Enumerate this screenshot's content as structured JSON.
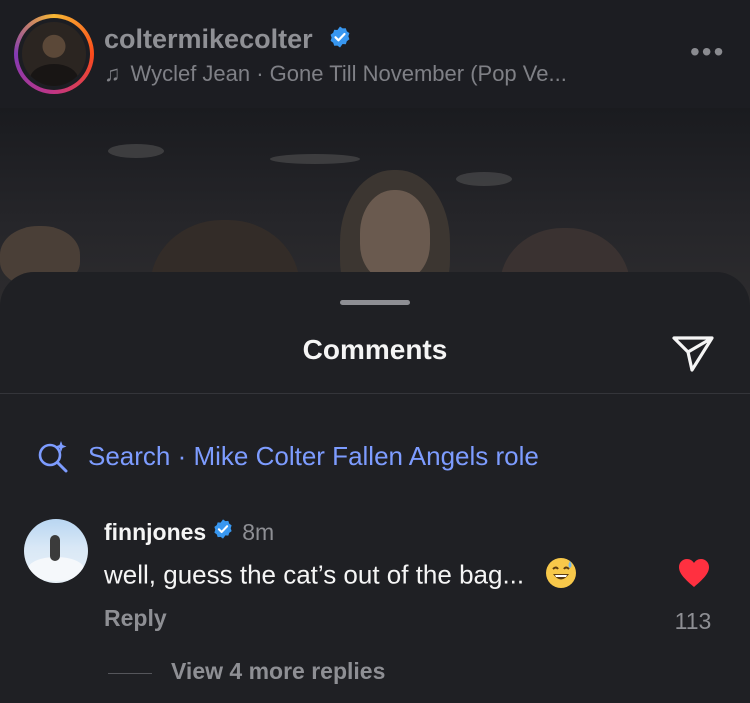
{
  "post": {
    "username": "coltermikecolter",
    "music": "Wyclef Jean · Gone Till November (Pop Ve...",
    "more_label": "•••"
  },
  "comments_sheet": {
    "title": "Comments",
    "search_text": "Search · Mike Colter Fallen Angels role"
  },
  "comment": {
    "username": "finnjones",
    "time": "8m",
    "text": "well, guess the cat’s out of the bag...",
    "reply_label": "Reply",
    "likes": "113",
    "view_replies": "View 4 more replies"
  },
  "colors": {
    "accent_link": "#7d9cff",
    "verified": "#3897f0",
    "heart": "#ff3040"
  }
}
